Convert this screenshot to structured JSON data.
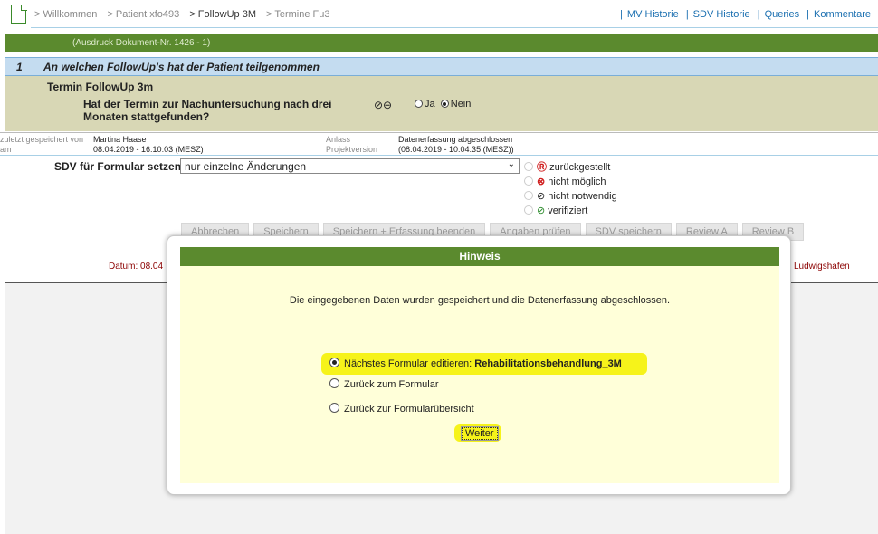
{
  "breadcrumb": {
    "items": [
      "> Willkommen",
      "> Patient xfo493",
      "> FollowUp 3M",
      "> Termine Fu3"
    ],
    "current_index": 2
  },
  "top_links": {
    "mv_historie": "MV Historie",
    "sdv_historie": "SDV Historie",
    "queries": "Queries",
    "kommentare": "Kommentare"
  },
  "print_doc": "(Ausdruck Dokument-Nr. 1426 - 1)",
  "section": {
    "number": "1",
    "title": "An welchen FollowUp's hat der Patient teilgenommen"
  },
  "question": {
    "group_title": "Termin FollowUp 3m",
    "text": "Hat der Termin zur Nachuntersuchung nach drei Monaten stattgefunden?",
    "status_icons": "⊘⊖",
    "option_yes": "Ja",
    "option_no": "Nein",
    "selected": "Nein"
  },
  "meta": {
    "saved_by_label": "zuletzt gespeichert von",
    "saved_by_label2": "am",
    "saved_by": "Martina Haase",
    "saved_at": "08.04.2019 - 16:10:03 (MESZ)",
    "anlass_label": "Anlass",
    "projektversion_label": "Projektversion",
    "anlass": "Datenerfassung abgeschlossen",
    "anlass_time": "(08.04.2019 - 10:04:35 (MESZ))"
  },
  "sdv": {
    "label": "SDV für Formular setzen:",
    "select_value": "nur einzelne Änderungen",
    "options": [
      "zurückgestellt",
      "nicht möglich",
      "nicht notwendig",
      "verifiziert"
    ]
  },
  "buttons": {
    "abbrechen": "Abbrechen",
    "speichern": "Speichern",
    "speichern_beenden": "Speichern + Erfassung beenden",
    "angaben_pruefen": "Angaben prüfen",
    "sdv_speichern": "SDV speichern",
    "review_a": "Review A",
    "review_b": "Review B"
  },
  "footer": {
    "datum": "Datum: 08.04",
    "ort": "Ludwigshafen"
  },
  "dialog": {
    "title": "Hinweis",
    "message": "Die eingegebenen Daten wurden gespeichert und die Datenerfassung abgeschlossen.",
    "option1_prefix": "Nächstes Formular editieren: ",
    "option1_form": "Rehabilitationsbehandlung_3M",
    "option2": "Zurück zum Formular",
    "option3": "Zurück zur Formularübersicht",
    "submit": "Weiter",
    "highlight_color": "#f6f31a",
    "header_color": "#5b8a2e"
  }
}
